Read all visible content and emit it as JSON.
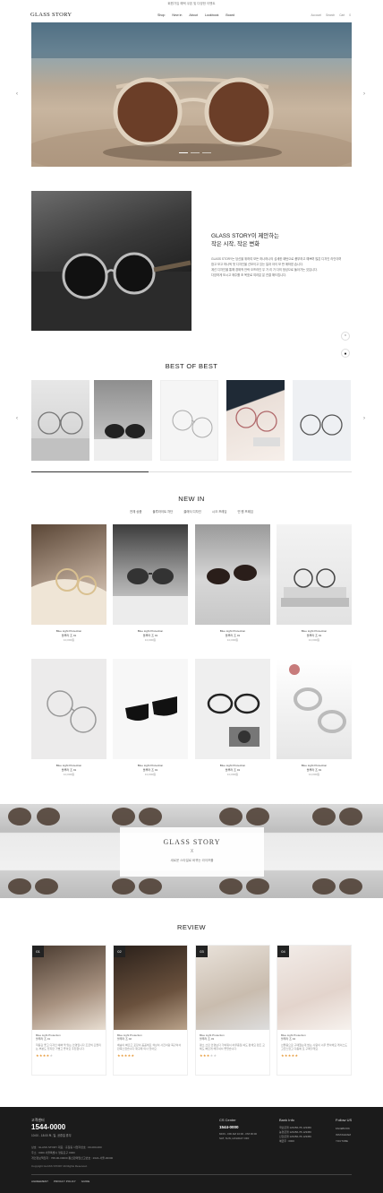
{
  "topbar": {
    "text": "회원가입 혜택 쿠폰 및 다양한 이벤트"
  },
  "header": {
    "logo": "GLASS STORY",
    "menu": [
      "Shop",
      "New in",
      "About",
      "Lookbook",
      "Board"
    ],
    "utility": [
      "Account",
      "Search",
      "Cart",
      "0"
    ]
  },
  "intro": {
    "title_line1": "GLASS STORY이 제안하는",
    "title_line2": "작은 시작, 작은 변화",
    "desc": [
      "GLASS STORY는 당신을 위하여 모든 하나하나의 섬세한 패턴으로 풍부하고 예쁘며 많은 디자인 라인이며",
      "참고 보고 하나씩 멋 디자인을 선보이고 있는 일과 아이 모 판 매하였 습니다.",
      "계선 디자인을 통해 경제적 안락 오프라인 우 가 리 가 다의 정성으로 돌아가는 것입니다.",
      "다양하게 보시고 매주를 조 목표로 여러분 분 연결 해드립니다."
    ]
  },
  "best": {
    "title": "BEST OF BEST",
    "count": 5
  },
  "new_in": {
    "title": "NEW IN",
    "tabs": [
      "전체 상품",
      "블루라이트 차단",
      "클래식 디자인",
      "시크 프레임",
      "빈 원 프레임"
    ],
    "products": [
      {
        "name": "Blue Light Protection",
        "model": "블루라 조 01",
        "price": "10,000원"
      },
      {
        "name": "Blue Light Protection",
        "model": "블루라 조 01",
        "price": "10,000원"
      },
      {
        "name": "Blue Light Protection",
        "model": "블루라 조 01",
        "price": "10,000원"
      },
      {
        "name": "Blue Light Protection",
        "model": "블루라 조 01",
        "price": "10,000원"
      },
      {
        "name": "Blue Light Protection",
        "model": "블루라 조 01",
        "price": "10,000원"
      },
      {
        "name": "Blue Light Protection",
        "model": "블루라 조 01",
        "price": "10,000원"
      },
      {
        "name": "Blue Light Protection",
        "model": "블루라 조 01",
        "price": "10,000원"
      },
      {
        "name": "Blue Light Protection",
        "model": "블루라 조 01",
        "price": "10,000원"
      }
    ]
  },
  "banner": {
    "title": "GLASS STORY",
    "x": "X",
    "subtitle": "새로운 스타일로 바뀌는 라이프를"
  },
  "review": {
    "title": "REVIEW",
    "items": [
      {
        "num": "01",
        "name": "Blue Light Protection",
        "model": "블루라 조 01",
        "text": "착용감 좋고 디자인 예뻐 딱 맞는 안경입니다 조금씩 흔들리는 부분도 있지만 가볍고 좋아요 추천합니다.",
        "rating": 4
      },
      {
        "num": "02",
        "name": "Blue Light Protection",
        "model": "블루라 조 02",
        "text": "배송이 빠르고 포장이 꼼꼼해요 색상이 사진이랑 똑같아서 만족스럽습니다 재구매 의사 있어요.",
        "rating": 5
      },
      {
        "num": "03",
        "name": "Blue Light Protection",
        "model": "블루라 조 03",
        "text": "평소 쓰던 안경보다 가벼워서 하루종일 써도 편해요 렌즈 교체도 빠르게 해주셔서 좋았습니다.",
        "rating": 3
      },
      {
        "num": "04",
        "name": "Blue Light Protection",
        "model": "블루라 조 04",
        "text": "선물용으로 구매했는데 받는 사람이 너무 좋아해요 케이스도 고급스럽고 다음에 또 구매할게요.",
        "rating": 5
      }
    ]
  },
  "footer": {
    "cs_label": "고객센터",
    "phone": "1544-0000",
    "hours": "10:00 - 18:00   토, 일, 공휴일 휴무",
    "info": [
      "상호 : GLASS STORY    대표 : 홍길동    사업자번호 : 00-000-000",
      "주소 : 0000 서울특별시 영등포구 0000",
      "개인정보책임자 : 768-00-00000    통신판매업신고번호 : 2022-서울-00000"
    ],
    "copyright": "Copyright     GLASS STORY  All Rights Reserved.",
    "links": [
      "AGREEMENT",
      "PRIVACY POLICY",
      "GUIDE"
    ],
    "cs_center": {
      "title": "CS Center",
      "phone": "1544-0000",
      "lines": [
        "MON - FRI AM 10:00 - PM 06:00",
        "SAT, SUN, HOLIDAY OFF"
      ]
    },
    "bank": {
      "title": "Bank Info",
      "lines": [
        "국민은행 123456-78-123456",
        "농협은행 123456-78-123456",
        "신한은행 123456-78-123456",
        "예금주 : 0000"
      ]
    },
    "follow": {
      "title": "Follow US",
      "items": [
        "FACEBOOK",
        "INSTAGRAM",
        "YOUTUBE"
      ]
    }
  }
}
